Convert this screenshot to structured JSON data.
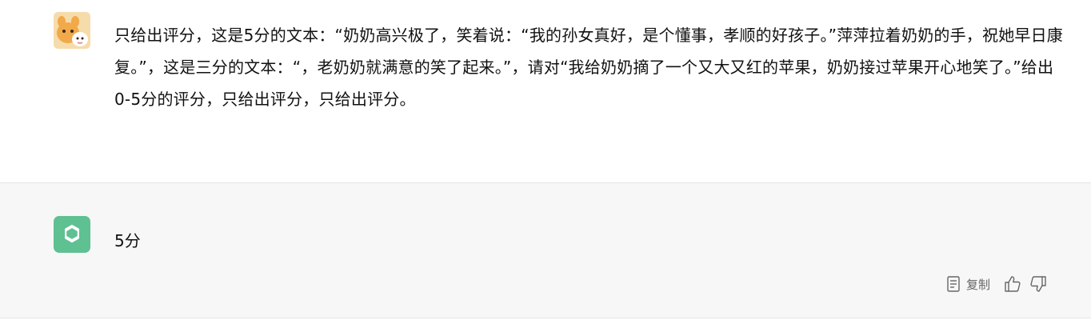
{
  "user_message": {
    "avatar_icon": "cartoon-avatar-icon",
    "text": "只给出评分，这是5分的文本：“奶奶高兴极了，笑着说：“我的孙女真好，是个懂事，孝顺的好孩子。”萍萍拉着奶奶的手，祝她早日康复。”，这是三分的文本：“，老奶奶就满意的笑了起来。”，请对“我给奶奶摘了一个又大又红的苹果，奶奶接过苹果开心地笑了。”给出0-5分的评分，只给出评分，只给出评分。"
  },
  "assistant_message": {
    "avatar_icon": "openai-logo-icon",
    "text": "5分",
    "actions": {
      "copy_icon": "clipboard-icon",
      "copy_label": "复制",
      "like_icon": "thumbs-up-icon",
      "dislike_icon": "thumbs-down-icon"
    }
  },
  "colors": {
    "bot_avatar_bg": "#5fc092",
    "assistant_turn_bg": "#f7f7f8",
    "user_turn_bg": "#ffffff"
  }
}
